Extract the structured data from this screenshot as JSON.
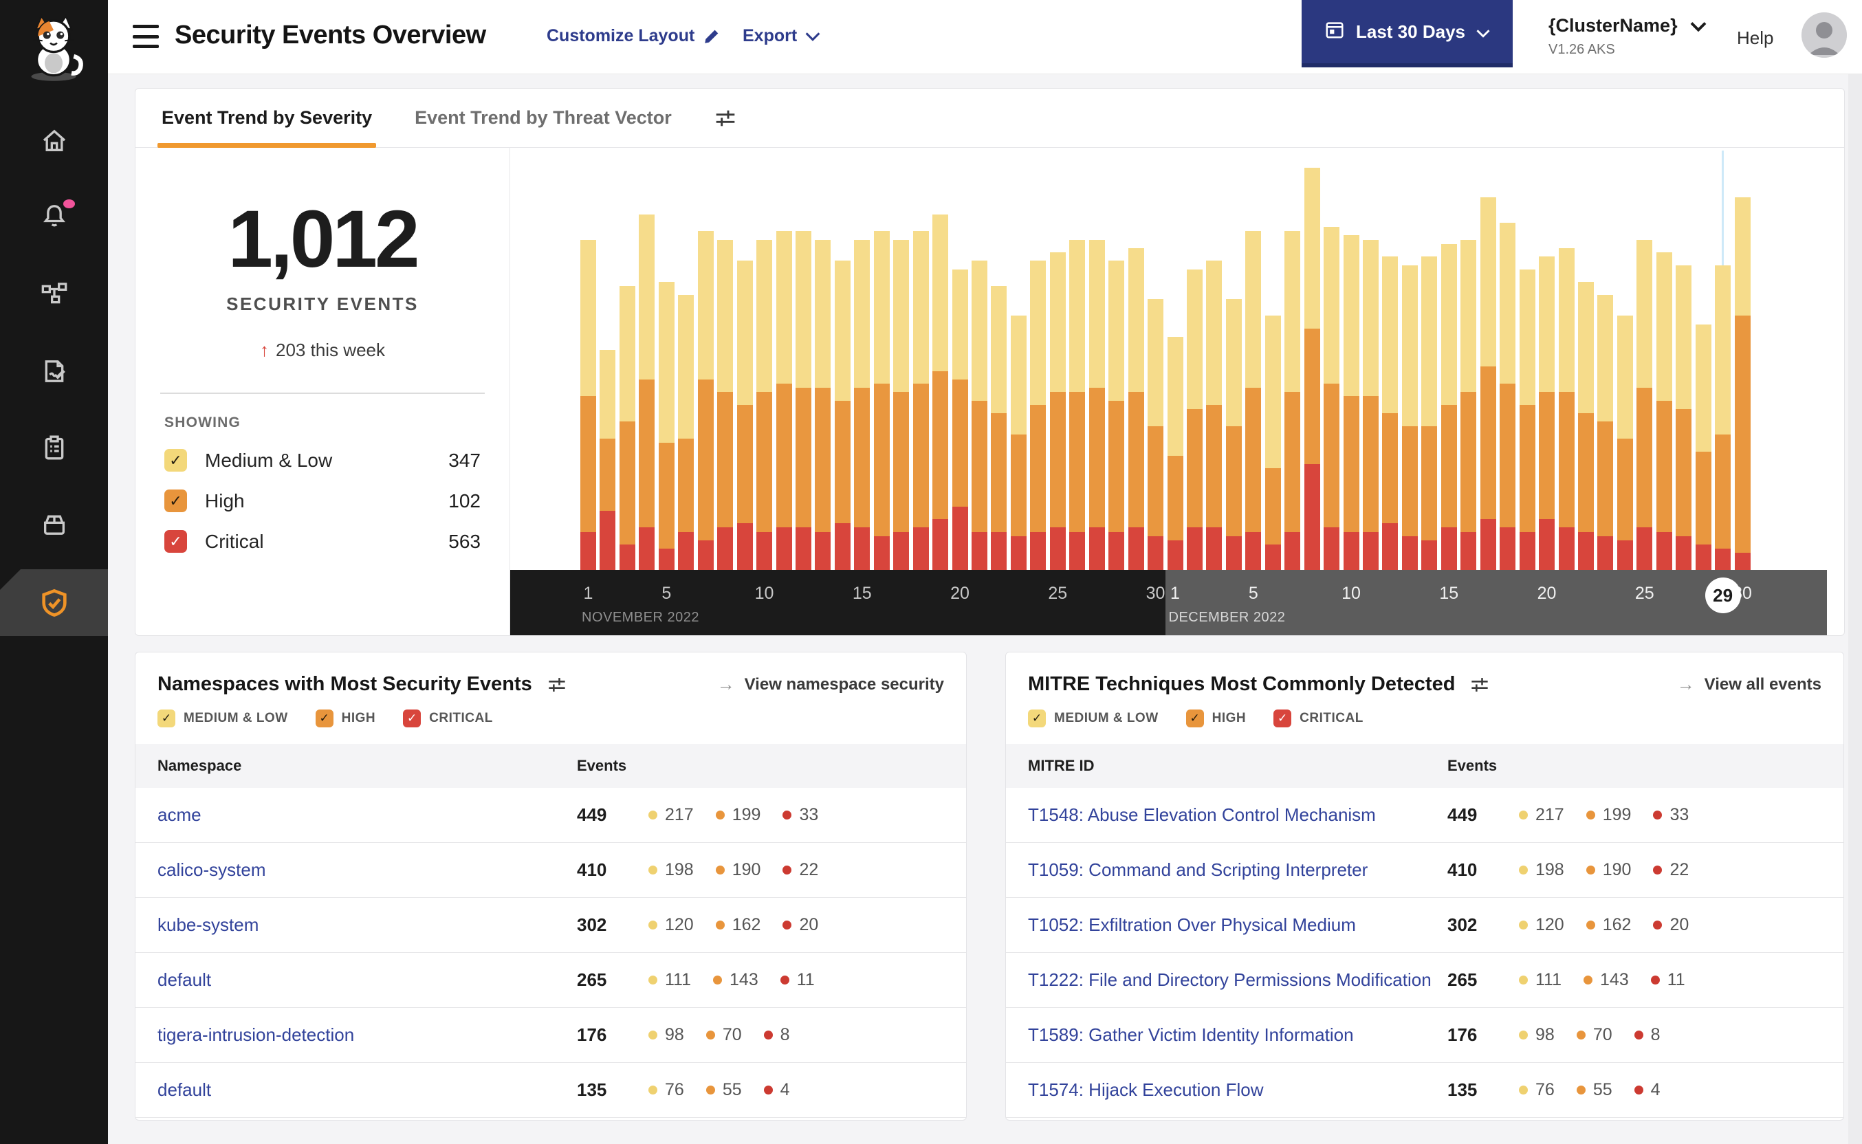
{
  "header": {
    "title": "Security Events Overview",
    "customize_layout": "Customize Layout",
    "export_label": "Export",
    "date_range": "Last 30 Days",
    "cluster_name": "{ClusterName}",
    "cluster_version": "V1.26 AKS",
    "help": "Help"
  },
  "sidebar": {
    "items": [
      "home",
      "alerts",
      "service-graph",
      "policies",
      "compliance-reports",
      "manage",
      "threat-defense"
    ],
    "active_item": "threat-defense",
    "accent_color": "#EF9327"
  },
  "tabs": [
    {
      "label": "Event Trend by Severity",
      "active": true
    },
    {
      "label": "Event Trend by Threat Vector",
      "active": false
    }
  ],
  "summary": {
    "total": "1,012",
    "label": "SECURITY EVENTS",
    "delta_arrow": "↑",
    "delta": "203 this week",
    "showing_label": "SHOWING",
    "filters": [
      {
        "label": "Medium & Low",
        "count": 347,
        "color": "#F3D87A",
        "checked": true
      },
      {
        "label": "High",
        "count": 102,
        "color": "#E8953C",
        "checked": true
      },
      {
        "label": "Critical",
        "count": 563,
        "color": "#D8453C",
        "checked": true
      }
    ]
  },
  "chart_data": {
    "type": "bar",
    "stacked": true,
    "grid": false,
    "y_axis_visible": false,
    "ylim": [
      0,
      100
    ],
    "note": "values are relative units estimated from pixel heights; 100 = full plot height",
    "colors": {
      "medium_low": "#F6DC8B",
      "high": "#E9973F",
      "critical": "#D8453C"
    },
    "stack_order_bottom_to_top": [
      "critical",
      "high",
      "medium_low"
    ],
    "categories": [
      "Nov 1",
      "Nov 2",
      "Nov 3",
      "Nov 4",
      "Nov 5",
      "Nov 6",
      "Nov 7",
      "Nov 8",
      "Nov 9",
      "Nov 10",
      "Nov 11",
      "Nov 12",
      "Nov 13",
      "Nov 14",
      "Nov 15",
      "Nov 16",
      "Nov 17",
      "Nov 18",
      "Nov 19",
      "Nov 20",
      "Nov 21",
      "Nov 22",
      "Nov 23",
      "Nov 24",
      "Nov 25",
      "Nov 26",
      "Nov 27",
      "Nov 28",
      "Nov 29",
      "Nov 30",
      "Dec 1",
      "Dec 2",
      "Dec 3",
      "Dec 4",
      "Dec 5",
      "Dec 6",
      "Dec 7",
      "Dec 8",
      "Dec 9",
      "Dec 10",
      "Dec 11",
      "Dec 12",
      "Dec 13",
      "Dec 14",
      "Dec 15",
      "Dec 16",
      "Dec 17",
      "Dec 18",
      "Dec 19",
      "Dec 20",
      "Dec 21",
      "Dec 22",
      "Dec 23",
      "Dec 24",
      "Dec 25",
      "Dec 26",
      "Dec 27",
      "Dec 28",
      "Dec 29",
      "Dec 30"
    ],
    "series": [
      {
        "name": "medium_low",
        "values": [
          37,
          21,
          32,
          39,
          38,
          34,
          35,
          36,
          34,
          36,
          36,
          37,
          35,
          33,
          35,
          36,
          36,
          36,
          37,
          26,
          33,
          30,
          28,
          34,
          33,
          36,
          35,
          33,
          34,
          30,
          28,
          33,
          34,
          30,
          37,
          36,
          38,
          38,
          37,
          38,
          37,
          37,
          38,
          40,
          38,
          36,
          40,
          38,
          32,
          32,
          34,
          31,
          30,
          29,
          35,
          35,
          34,
          30,
          40,
          28
        ]
      },
      {
        "name": "high",
        "values": [
          32,
          17,
          29,
          35,
          25,
          22,
          38,
          32,
          28,
          33,
          34,
          33,
          34,
          29,
          33,
          36,
          33,
          34,
          35,
          30,
          31,
          28,
          24,
          30,
          32,
          33,
          33,
          31,
          32,
          26,
          20,
          28,
          29,
          26,
          34,
          18,
          33,
          32,
          34,
          32,
          32,
          26,
          26,
          27,
          29,
          33,
          36,
          34,
          30,
          30,
          32,
          28,
          27,
          24,
          33,
          31,
          30,
          22,
          27,
          56
        ]
      },
      {
        "name": "critical",
        "values": [
          9,
          14,
          6,
          10,
          5,
          9,
          7,
          10,
          11,
          9,
          10,
          10,
          9,
          11,
          10,
          8,
          9,
          10,
          12,
          15,
          9,
          9,
          8,
          9,
          10,
          9,
          10,
          9,
          10,
          8,
          7,
          10,
          10,
          8,
          9,
          6,
          9,
          25,
          10,
          9,
          9,
          11,
          8,
          7,
          10,
          9,
          12,
          10,
          9,
          12,
          10,
          9,
          8,
          7,
          10,
          9,
          8,
          6,
          5,
          4
        ]
      }
    ],
    "axis": {
      "months": [
        {
          "label": "NOVEMBER 2022",
          "ticks": [
            1,
            5,
            10,
            15,
            20,
            25,
            30
          ],
          "start_index": 0,
          "band_color": "#1B1B1B"
        },
        {
          "label": "DECEMBER 2022",
          "ticks": [
            1,
            5,
            10,
            15,
            20,
            25,
            30
          ],
          "start_index": 30,
          "band_color": "#5C5C5C"
        }
      ],
      "highlight": {
        "category_index": 58,
        "label": "29",
        "marker_color": "#CEE9F8"
      }
    },
    "legend_position": "left-panel (SHOWING filters)"
  },
  "panels": [
    {
      "title": "Namespaces with Most Security Events",
      "link": "View namespace security",
      "filters": [
        "MEDIUM & LOW",
        "HIGH",
        "CRITICAL"
      ],
      "columns": [
        "Namespace",
        "Events"
      ],
      "rows": [
        {
          "name": "acme",
          "total": 449,
          "medium_low": 217,
          "high": 199,
          "critical": 33
        },
        {
          "name": "calico-system",
          "total": 410,
          "medium_low": 198,
          "high": 190,
          "critical": 22
        },
        {
          "name": "kube-system",
          "total": 302,
          "medium_low": 120,
          "high": 162,
          "critical": 20
        },
        {
          "name": "default",
          "total": 265,
          "medium_low": 111,
          "high": 143,
          "critical": 11
        },
        {
          "name": "tigera-intrusion-detection",
          "total": 176,
          "medium_low": 98,
          "high": 70,
          "critical": 8
        },
        {
          "name": "default",
          "total": 135,
          "medium_low": 76,
          "high": 55,
          "critical": 4
        }
      ]
    },
    {
      "title": "MITRE Techniques Most Commonly Detected",
      "link": "View all events",
      "filters": [
        "MEDIUM & LOW",
        "HIGH",
        "CRITICAL"
      ],
      "columns": [
        "MITRE ID",
        "Events"
      ],
      "rows": [
        {
          "name": "T1548: Abuse Elevation Control Mechanism",
          "total": 449,
          "medium_low": 217,
          "high": 199,
          "critical": 33
        },
        {
          "name": "T1059: Command and Scripting Interpreter",
          "total": 410,
          "medium_low": 198,
          "high": 190,
          "critical": 22
        },
        {
          "name": "T1052: Exfiltration Over Physical Medium",
          "total": 302,
          "medium_low": 120,
          "high": 162,
          "critical": 20
        },
        {
          "name": "T1222: File and Directory Permissions Modification",
          "total": 265,
          "medium_low": 111,
          "high": 143,
          "critical": 11
        },
        {
          "name": "T1589: Gather Victim Identity Information",
          "total": 176,
          "medium_low": 98,
          "high": 70,
          "critical": 8
        },
        {
          "name": "T1574: Hijack Execution Flow",
          "total": 135,
          "medium_low": 76,
          "high": 55,
          "critical": 4
        }
      ]
    }
  ]
}
